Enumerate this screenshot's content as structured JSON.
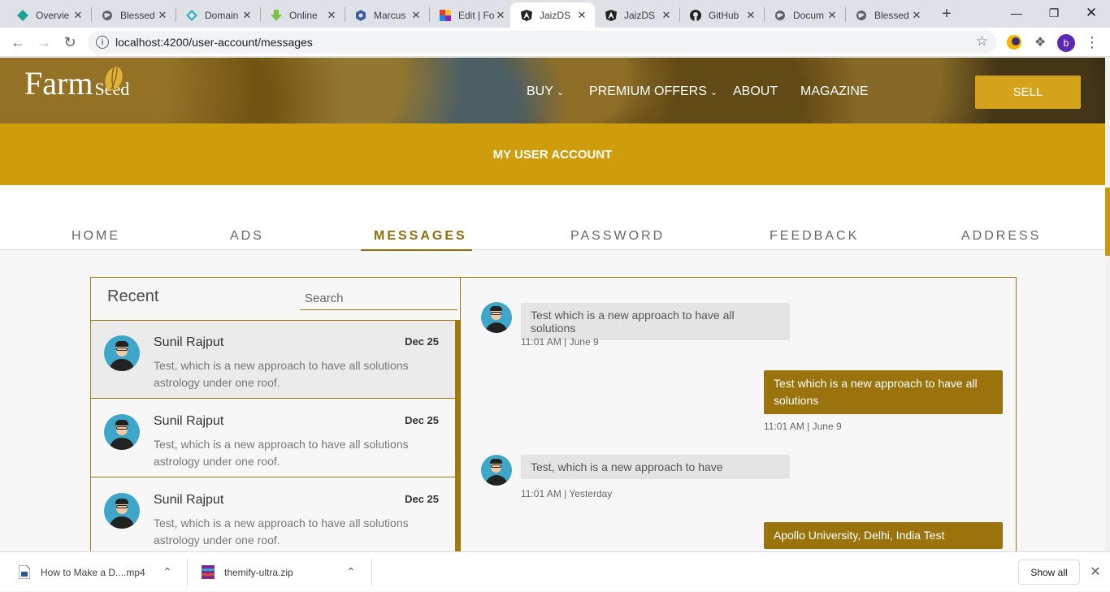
{
  "browser": {
    "tabs": [
      {
        "title": "Overvie",
        "icon": "azure-devops-icon"
      },
      {
        "title": "Blessed",
        "icon": "globe-icon"
      },
      {
        "title": "Domain",
        "icon": "diamond-icon"
      },
      {
        "title": "Online",
        "icon": "download-arrow-icon"
      },
      {
        "title": "Marcus",
        "icon": "hexagon-icon"
      },
      {
        "title": "Edit | Fo",
        "icon": "color-squares-icon"
      },
      {
        "title": "JaizDS",
        "icon": "angular-icon"
      },
      {
        "title": "JaizDS",
        "icon": "angular-icon"
      },
      {
        "title": "GitHub",
        "icon": "github-icon"
      },
      {
        "title": "Docum",
        "icon": "globe-icon"
      },
      {
        "title": "Blessed",
        "icon": "globe-icon"
      }
    ],
    "active_tab_index": 6,
    "url": "localhost:4200/user-account/messages",
    "profile_initial": "b"
  },
  "site": {
    "logo_farm": "Farm",
    "logo_seed": "Seed",
    "menu": {
      "buy": "BUY",
      "premium": "PREMIUM OFFERS",
      "about": "ABOUT",
      "magazine": "MAGAZINE"
    },
    "sell": "SELL",
    "banner": "MY USER ACCOUNT",
    "subtabs": [
      "HOME",
      "ADS",
      "MESSAGES",
      "PASSWORD",
      "FEEDBACK",
      "ADDRESS"
    ],
    "active_subtab": "MESSAGES",
    "accent": "#cf9c0c"
  },
  "chat": {
    "recent_title": "Recent",
    "search_placeholder": "Search",
    "conversations": [
      {
        "name": "Sunil Rajput",
        "date": "Dec 25",
        "preview": "Test, which is a new approach to have all solutions astrology under one roof."
      },
      {
        "name": "Sunil Rajput",
        "date": "Dec 25",
        "preview": "Test, which is a new approach to have all solutions astrology under one roof."
      },
      {
        "name": "Sunil Rajput",
        "date": "Dec 25",
        "preview": "Test, which is a new approach to have all solutions astrology under one roof."
      }
    ],
    "messages": [
      {
        "direction": "in",
        "text": "Test which is a new approach to have all solutions",
        "time": "11:01 AM | June 9"
      },
      {
        "direction": "out",
        "text": "Test which is a new approach to have all solutions",
        "time": "11:01 AM | June 9"
      },
      {
        "direction": "in",
        "text": "Test, which is a new approach to have",
        "time": "11:01 AM | Yesterday"
      },
      {
        "direction": "out",
        "text": "Apollo University, Delhi, India Test",
        "time": ""
      }
    ]
  },
  "downloads": {
    "items": [
      {
        "name": "How to Make a D....mp4",
        "icon": "video-file-icon"
      },
      {
        "name": "themify-ultra.zip",
        "icon": "archive-file-icon"
      }
    ],
    "show_all": "Show all"
  }
}
